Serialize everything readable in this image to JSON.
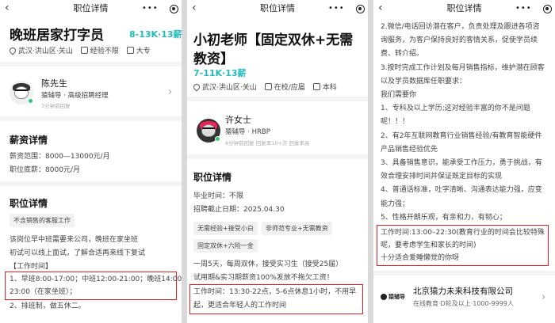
{
  "nav": {
    "back_icon": "‹",
    "title": "职位详情",
    "menu_dots": "•••"
  },
  "panel1": {
    "job_title": "晚班居家打字员",
    "salary": "8-13K·13薪",
    "meta": {
      "location": "武汉·洪山区·关山",
      "experience": "经验不限",
      "education": "大专"
    },
    "recruiter": {
      "name": "陈先生",
      "title": "猿辅导 · 高级招聘经理",
      "status": "3分钟前回复"
    },
    "salary_section": {
      "heading": "薪资详情",
      "range_label": "薪资范围：",
      "range_value": "8000—13000元/月",
      "base_label": "职位底薪：",
      "base_value": "8000元/月"
    },
    "position_section": {
      "heading": "职位详情",
      "tag": "不含销售的客服工作",
      "desc_line1": "该岗位早中班需要来公司，晚班在家坐班",
      "desc_line2": "初试可以线上面试，了解合适再来线下复试",
      "desc_line3": "【工作时间】",
      "hl_line1": "1、早班8:00-17:00；中班12:00-21:00；晚班14:00-",
      "hl_line2": "23:00（在家坐班）；",
      "desc_line4": "2、排班制，做五休二。"
    }
  },
  "panel2": {
    "job_title_line1": "小初老师【固定双休+无需",
    "job_title_line2": "教资】",
    "salary": "7-11K·13薪",
    "meta": {
      "location": "武汉·洪山区·关山",
      "experience": "在校/应届",
      "education": "本科"
    },
    "recruiter": {
      "name": "许女士",
      "title": "猿辅导 · HRBP",
      "status": "6分钟前回复  回复率10+次  回复率高"
    },
    "position_section": {
      "heading": "职位详情",
      "exp_label": "毕业时间：",
      "exp_value": "不限",
      "deadline_label": "招聘截止日期：",
      "deadline_value": "2025.04.30",
      "tags": [
        "无需经验+接受小白",
        "非师范专业+无需教资",
        "固定双休+六险一金"
      ],
      "desc_line1": "一周5天，每周双休，接受实习生（接受25届）",
      "desc_line2": "试用期&实习期薪资100%发放不拖欠工资！",
      "hl_line1": "工作时间：13:30-22点，5-6点休息1小时，不用早",
      "hl_line2": "起，更适合年轻人的工作时间"
    }
  },
  "panel3": {
    "lines": [
      "2.微信/电话回访潜在客户，负责处理及跟进各项咨",
      "询服务，为客户保持良好的客情关系，促使学员续",
      "费、转介绍。",
      "3.按时完成工作计划及每月销售指标，维护潜在顾客",
      "以及学员数据库任职要求：",
      "我们需要你",
      "1、专科及以上学历;这对经验丰富的你不是问题",
      "呢！！！",
      "2、有2年互联网教育行业销售经验/有教育智能硬件",
      "产品销售经验优先",
      "3、具备销售意识，能承受工作压力，勇于挑战，有",
      "效合理安排时间并保证既定目标的实现",
      "4、普通话标准，吐字清晰、沟通表达能力强，应变",
      "能力强；",
      "5、性格开朗乐观，有亲和力，有韧心；"
    ],
    "hl_line1": "工作时间:13:00–22:30(教育行业的时间会比较特殊",
    "hl_line2": "呢，要考虑学生和家长的时间)",
    "hl_line3": "十分适合爱睡懒觉的你呀",
    "company": {
      "logo_text": "猿辅导",
      "name": "北京猿力未来科技有限公司",
      "info": "在线教育·D轮及以上·1000-9999人"
    }
  }
}
